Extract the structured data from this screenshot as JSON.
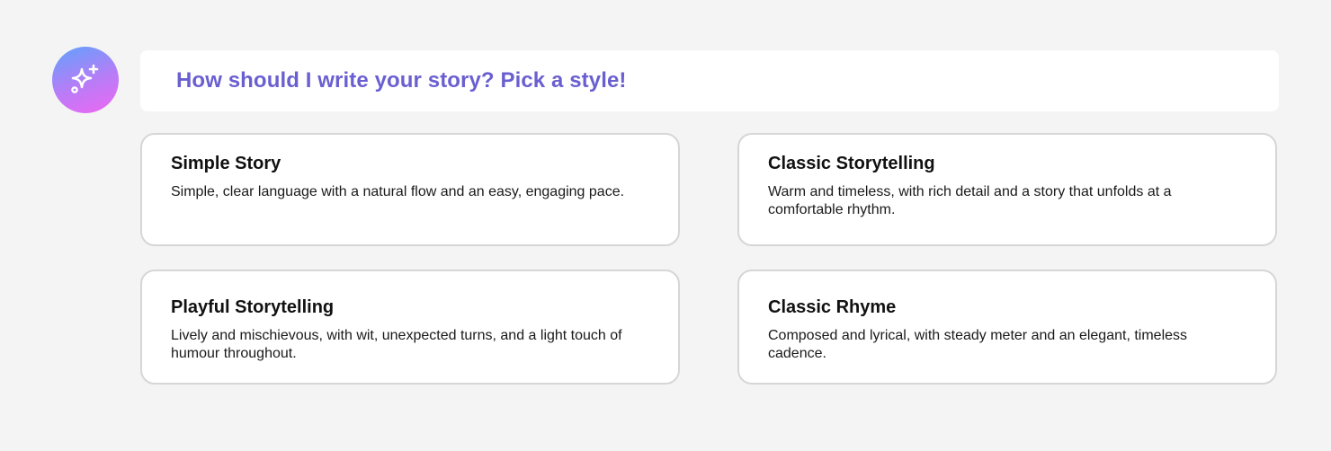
{
  "assistant": {
    "icon": "sparkles-icon",
    "prompt": "How should I write your story? Pick a style!"
  },
  "options": [
    {
      "title": "Simple Story",
      "description": "Simple, clear language with a natural flow and an easy, engaging pace."
    },
    {
      "title": "Classic Storytelling",
      "description": "Warm and timeless, with rich detail and a story that unfolds at a comfortable rhythm."
    },
    {
      "title": "Playful Storytelling",
      "description": "Lively and mischievous, with wit, unexpected turns, and a light touch of humour throughout."
    },
    {
      "title": "Classic Rhyme",
      "description": "Composed and lyrical, with steady meter and an elegant, timeless cadence."
    }
  ],
  "colors": {
    "background": "#f4f4f4",
    "prompt_text": "#6a5fd0",
    "card_border": "#d6d6d6",
    "avatar_gradient_start": "#5fa2fb",
    "avatar_gradient_end": "#ee67f2"
  }
}
